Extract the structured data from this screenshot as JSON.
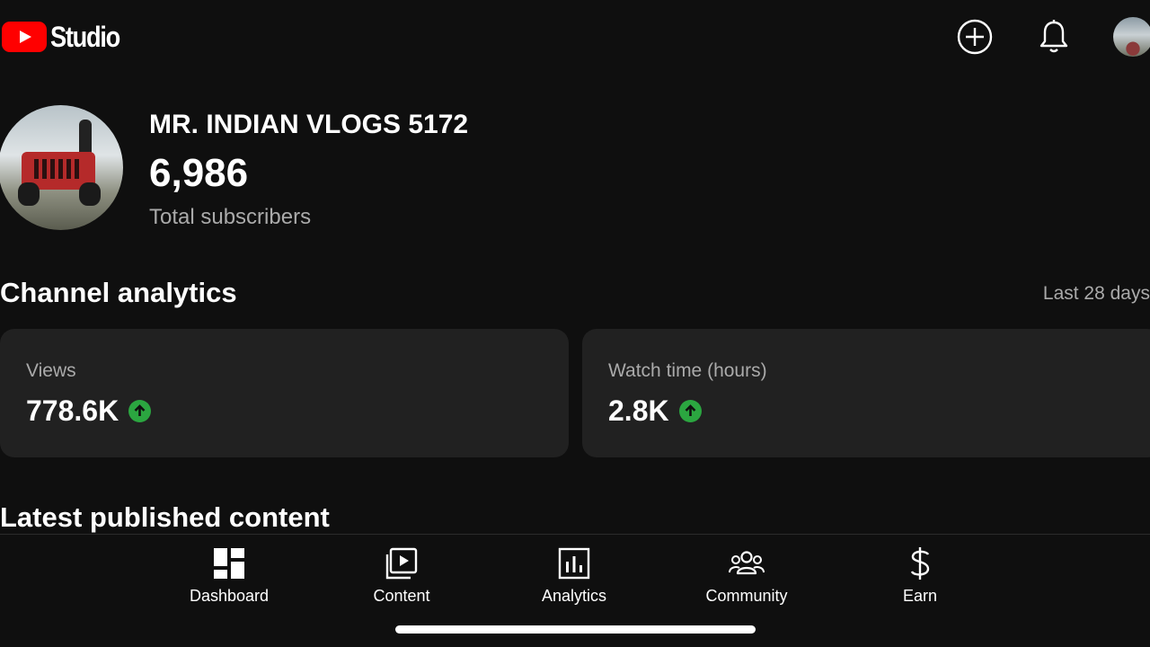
{
  "header": {
    "brand": "Studio",
    "icons": [
      "youtube-logo-icon",
      "create-icon",
      "notifications-icon",
      "account-avatar"
    ]
  },
  "channel": {
    "name": "MR. INDIAN VLOGS 5172",
    "subscriber_count": "6,986",
    "subscriber_label": "Total subscribers"
  },
  "analytics": {
    "title": "Channel analytics",
    "range": "Last 28 days",
    "cards": [
      {
        "label": "Views",
        "value": "778.6K",
        "trend": "up"
      },
      {
        "label": "Watch time (hours)",
        "value": "2.8K",
        "trend": "up"
      }
    ]
  },
  "latest": {
    "title": "Latest published content"
  },
  "nav": {
    "items": [
      {
        "label": "Dashboard",
        "icon": "dashboard-icon"
      },
      {
        "label": "Content",
        "icon": "content-icon"
      },
      {
        "label": "Analytics",
        "icon": "analytics-icon"
      },
      {
        "label": "Community",
        "icon": "community-icon"
      },
      {
        "label": "Earn",
        "icon": "earn-icon"
      }
    ]
  },
  "colors": {
    "background": "#0f0f0f",
    "card": "#212121",
    "brand_red": "#ff0000",
    "trend_green": "#2ba640",
    "secondary_text": "#aaaaaa"
  }
}
